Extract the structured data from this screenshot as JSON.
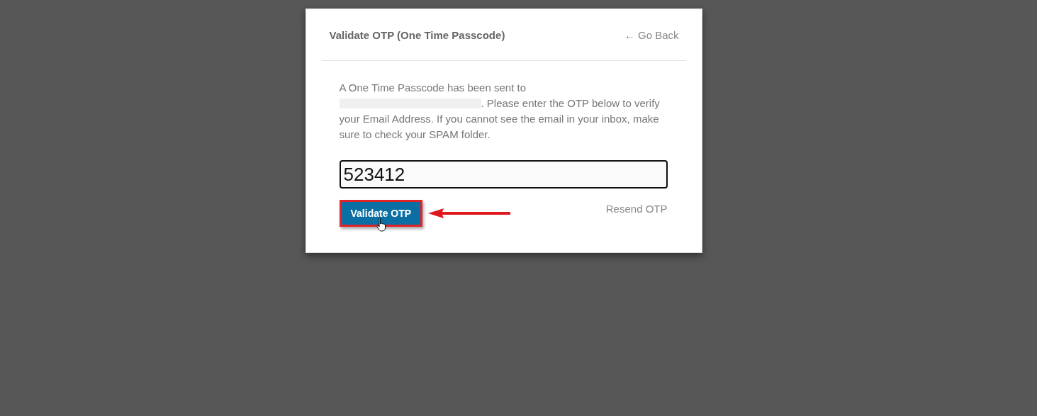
{
  "dialog": {
    "title": "Validate OTP (One Time Passcode)",
    "back_link": "← Go Back",
    "message_start": "A One Time Passcode has been sent to",
    "message_end": ". Please enter the OTP below to verify your Email Address. If you cannot see the email in your inbox, make sure to check your SPAM folder.",
    "otp_input": {
      "value": "523412"
    },
    "validate_button": {
      "label": "Validate OTP",
      "highlighted": true
    },
    "resend_link": "Resend OTP"
  }
}
